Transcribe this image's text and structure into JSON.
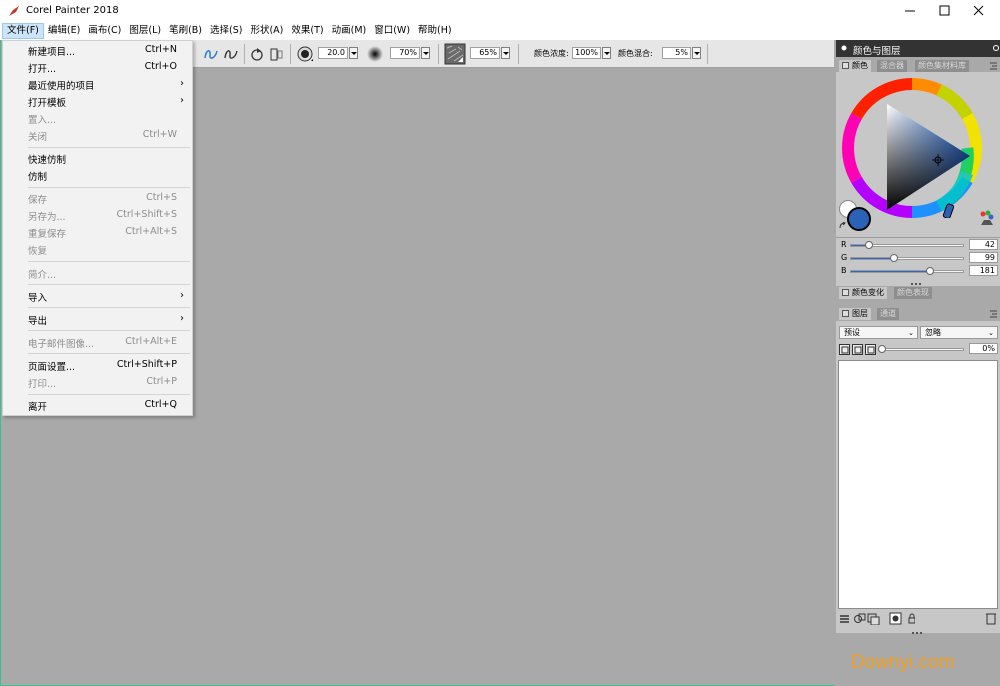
{
  "window": {
    "title": "Corel Painter 2018"
  },
  "menubar": {
    "items": [
      {
        "label": "文件(F)"
      },
      {
        "label": "编辑(E)"
      },
      {
        "label": "画布(C)"
      },
      {
        "label": "图层(L)"
      },
      {
        "label": "笔刷(B)"
      },
      {
        "label": "选择(S)"
      },
      {
        "label": "形状(A)"
      },
      {
        "label": "效果(T)"
      },
      {
        "label": "动画(M)"
      },
      {
        "label": "窗口(W)"
      },
      {
        "label": "帮助(H)"
      }
    ]
  },
  "file_menu": {
    "items": [
      {
        "label": "新建项目...",
        "shortcut": "Ctrl+N",
        "enabled": true
      },
      {
        "label": "打开...",
        "shortcut": "Ctrl+O",
        "enabled": true
      },
      {
        "label": "最近使用的项目",
        "submenu": true,
        "enabled": true
      },
      {
        "label": "打开模板",
        "submenu": true,
        "enabled": true
      },
      {
        "label": "置入...",
        "enabled": false
      },
      {
        "label": "关闭",
        "shortcut": "Ctrl+W",
        "enabled": false
      },
      {
        "label": "快速仿制",
        "enabled": true
      },
      {
        "label": "仿制",
        "enabled": true
      },
      {
        "label": "保存",
        "shortcut": "Ctrl+S",
        "enabled": false
      },
      {
        "label": "另存为...",
        "shortcut": "Ctrl+Shift+S",
        "enabled": false
      },
      {
        "label": "重复保存",
        "shortcut": "Ctrl+Alt+S",
        "enabled": false
      },
      {
        "label": "恢复",
        "enabled": false
      },
      {
        "label": "简介...",
        "enabled": false
      },
      {
        "label": "导入",
        "submenu": true,
        "enabled": true
      },
      {
        "label": "导出",
        "submenu": true,
        "enabled": true
      },
      {
        "label": "电子邮件图像...",
        "shortcut": "Ctrl+Alt+E",
        "enabled": false
      },
      {
        "label": "页面设置...",
        "shortcut": "Ctrl+Shift+P",
        "enabled": true
      },
      {
        "label": "打印...",
        "shortcut": "Ctrl+P",
        "enabled": false
      },
      {
        "label": "离开",
        "shortcut": "Ctrl+Q",
        "enabled": true
      }
    ]
  },
  "toolbar": {
    "size_value": "20.0",
    "opacity_value": "70%",
    "grain_value": "65%",
    "resat_label": "颜色浓度:",
    "resat_value": "100%",
    "bleed_label": "颜色混合:",
    "bleed_value": "5%"
  },
  "color_panel": {
    "title": "颜色与图层",
    "tabs": [
      "颜色",
      "混合器",
      "颜色集材料库"
    ],
    "main_color": "#2a63b5",
    "r_label": "R",
    "g_label": "G",
    "b_label": "B",
    "r_value": "42",
    "g_value": "99",
    "b_value": "181",
    "r": 42,
    "g": 99,
    "b": 181
  },
  "variation_panel": {
    "tabs": [
      "颜色变化",
      "颜色表现"
    ]
  },
  "layers_panel": {
    "tabs": [
      "图层",
      "通道"
    ],
    "preset_select": "预设",
    "composite_select": "忽略",
    "opacity_value": "0%"
  },
  "watermark": {
    "text": "Downyi.com"
  }
}
